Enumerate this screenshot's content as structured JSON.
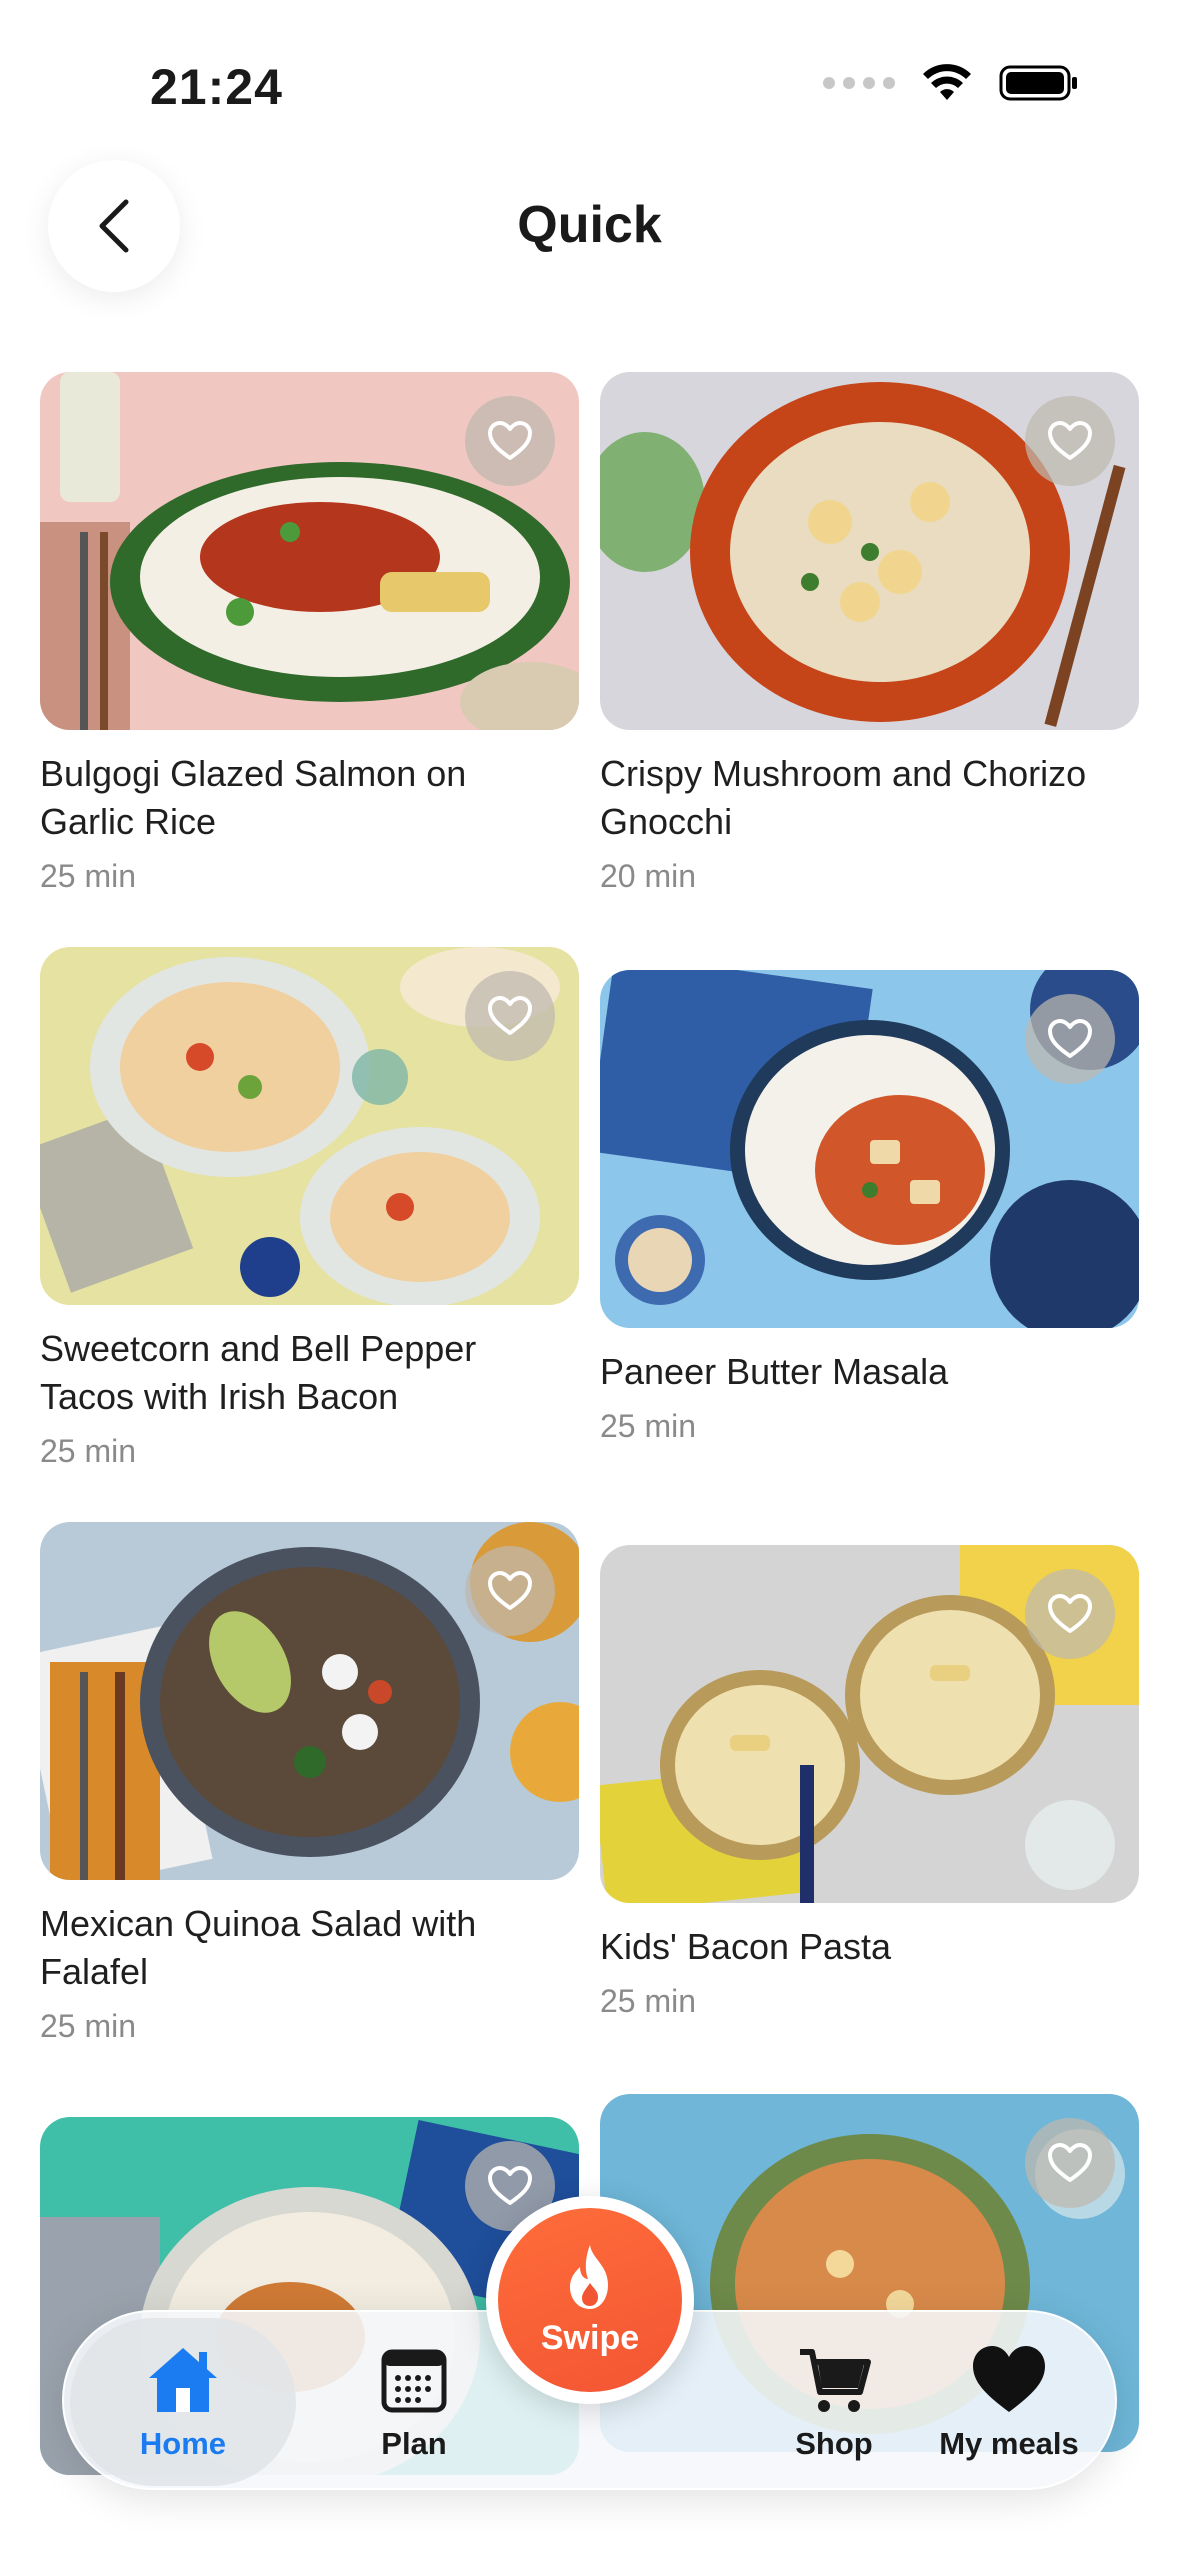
{
  "status_bar": {
    "time": "21:24"
  },
  "header": {
    "title": "Quick"
  },
  "recipes": [
    {
      "title": "Bulgogi Glazed Salmon on Garlic Rice",
      "time": "25 min"
    },
    {
      "title": "Crispy Mushroom and Chorizo Gnocchi",
      "time": "20 min"
    },
    {
      "title": "Sweetcorn and Bell Pepper Tacos with Irish Bacon",
      "time": "25 min"
    },
    {
      "title": "Paneer Butter Masala",
      "time": "25 min"
    },
    {
      "title": "Mexican Quinoa Salad with Falafel",
      "time": "25 min"
    },
    {
      "title": "Kids' Bacon Pasta",
      "time": "25 min"
    },
    {
      "title": "",
      "time": ""
    },
    {
      "title": "",
      "time": ""
    }
  ],
  "tabbar": {
    "home": "Home",
    "plan": "Plan",
    "swipe": "Swipe",
    "shop": "Shop",
    "my_meals": "My meals"
  },
  "colors": {
    "accent": "#1a7cf0",
    "swipe": "#f25533"
  }
}
